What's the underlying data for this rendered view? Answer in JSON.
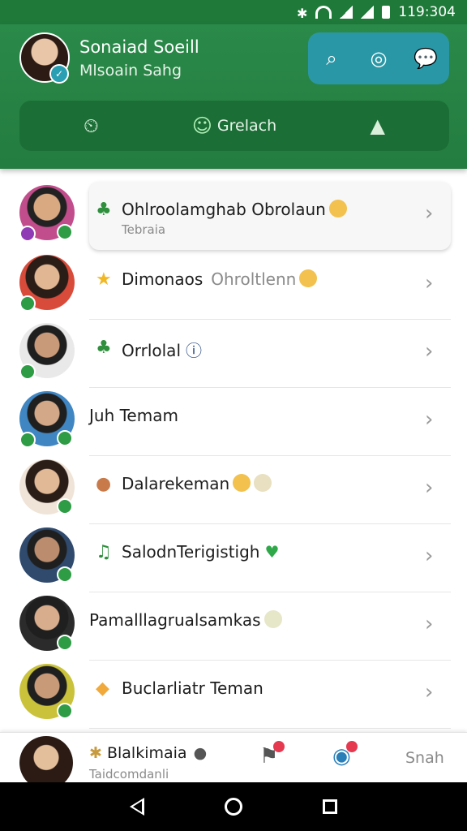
{
  "status_bar": {
    "time": "119:304"
  },
  "header": {
    "profile_name": "Sonaiad Soeill",
    "profile_sub": "Mlsoain Sahg",
    "tabs": [
      {
        "label": "",
        "icon": "timer-icon"
      },
      {
        "label": "Grelach",
        "icon": "contact-icon"
      },
      {
        "label": "",
        "icon": "flask-icon"
      }
    ]
  },
  "chats": [
    {
      "title": "Ohlroolamghab Obrolaun",
      "subtitle": "Tebraia",
      "extra": ""
    },
    {
      "title": "Dimonaos",
      "subtitle": "",
      "extra": "Ohroltlenn"
    },
    {
      "title": "Orrlolal",
      "subtitle": "",
      "extra": ""
    },
    {
      "title": "Juh Temam",
      "subtitle": "",
      "extra": ""
    },
    {
      "title": "Dalarekeman",
      "subtitle": "",
      "extra": ""
    },
    {
      "title": "SalodnTerigistigh",
      "subtitle": "",
      "extra": ""
    },
    {
      "title": "Pamalllagrualsamkas",
      "subtitle": "",
      "extra": ""
    },
    {
      "title": "Buclarliatr Teman",
      "subtitle": "",
      "extra": ""
    }
  ],
  "bottom_bar": {
    "name": "Blalkimaia",
    "sub": "Taidcomdanli",
    "right_label": "Snah"
  },
  "colors": {
    "header_green": "#237c40",
    "action_teal": "#2a97a6",
    "badge_green": "#2e9b45",
    "notif_red": "#e53950"
  }
}
